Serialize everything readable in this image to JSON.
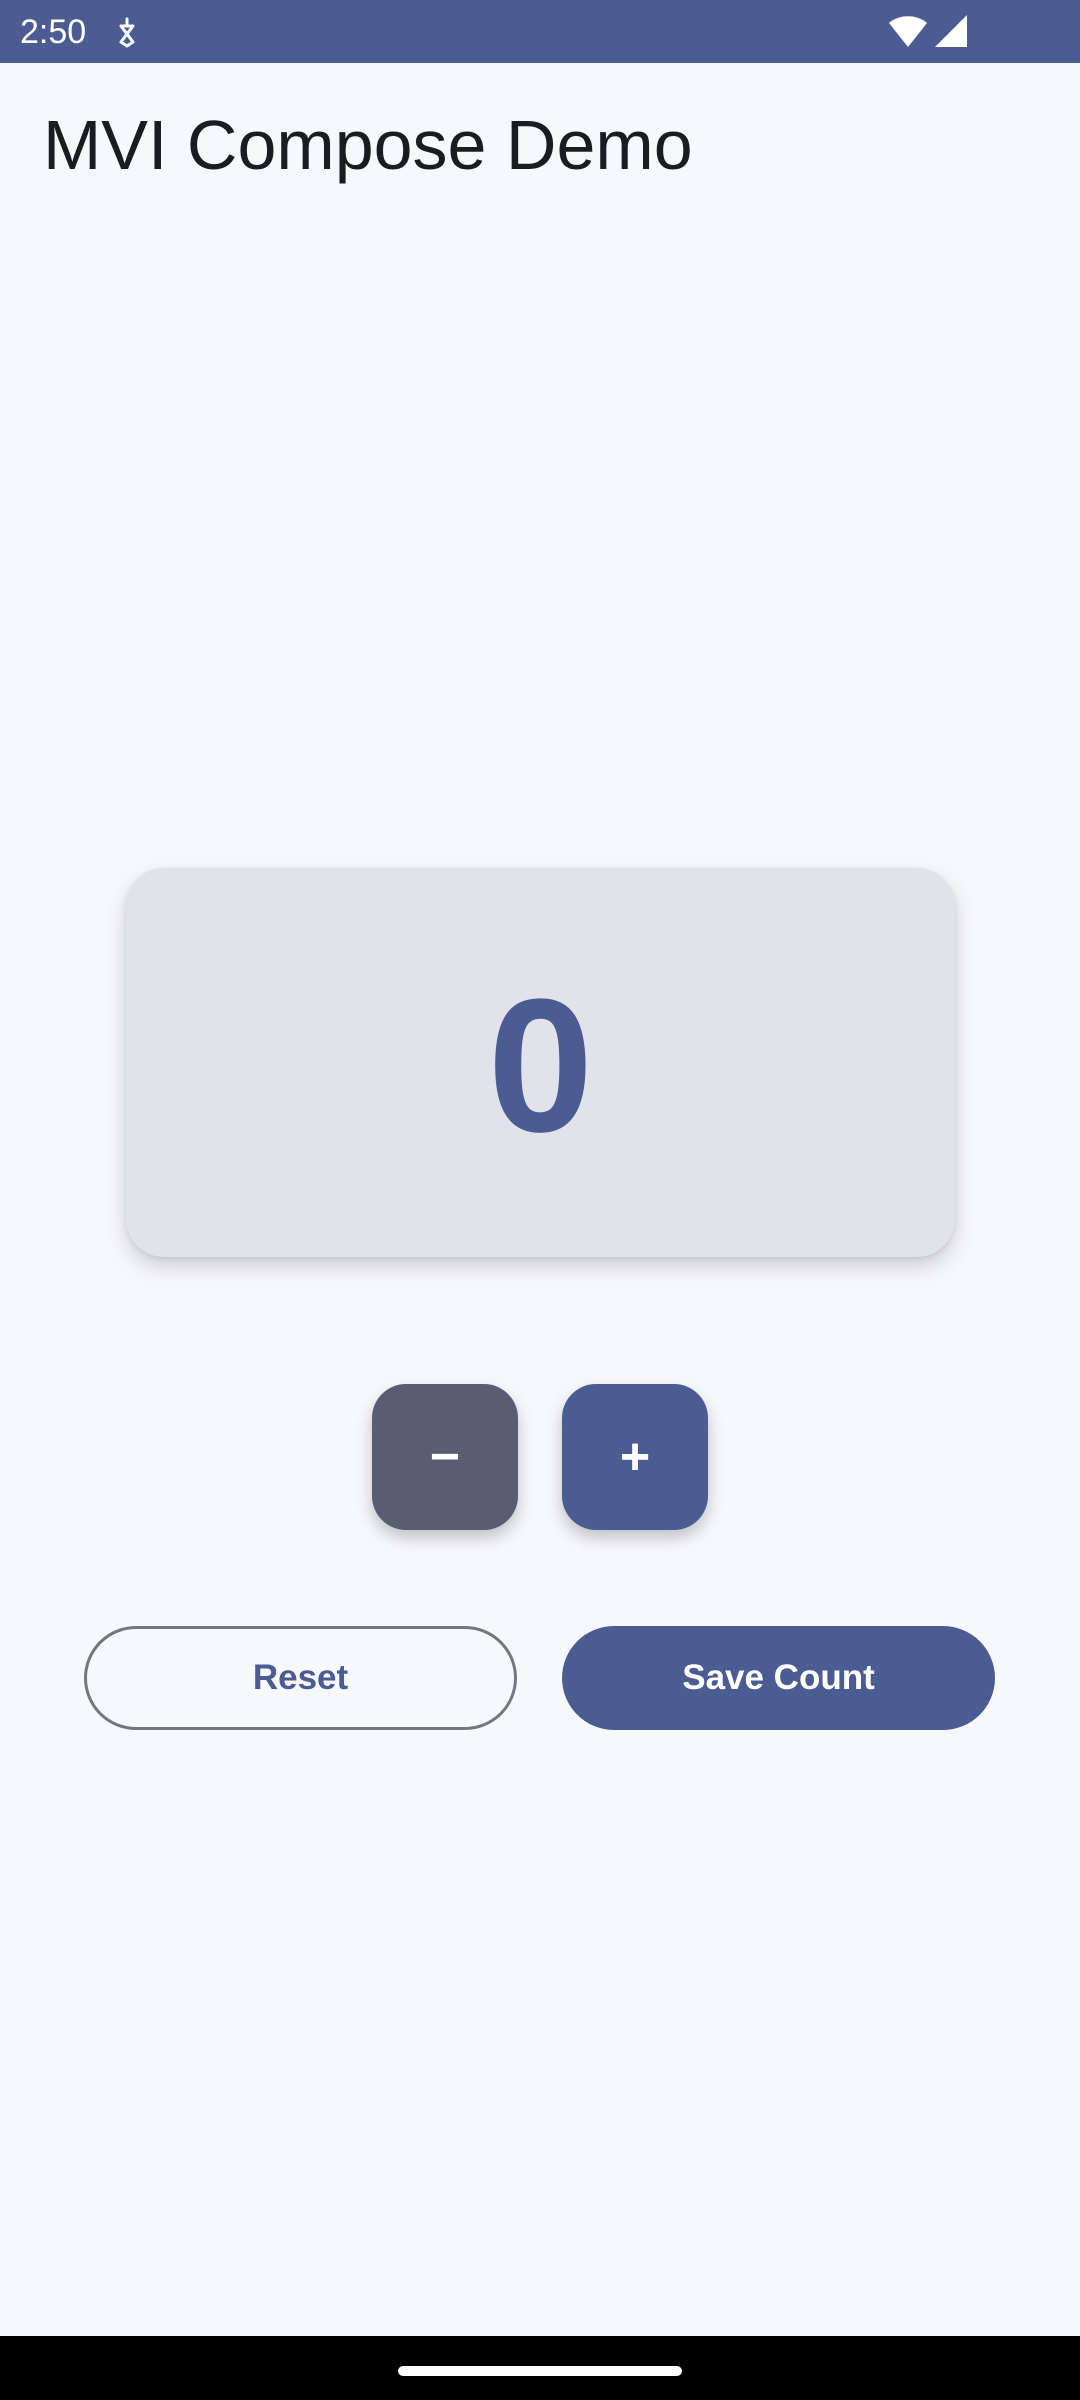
{
  "status_bar": {
    "time": "2:50",
    "background": "#4A5C92",
    "icons": [
      "notification-icon",
      "wifi-icon",
      "cell-signal-icon"
    ]
  },
  "app": {
    "title": "MVI Compose Demo"
  },
  "counter": {
    "value": "0"
  },
  "stepper": {
    "decrement_label": "−",
    "increment_label": "+"
  },
  "actions": {
    "reset_label": "Reset",
    "save_label": "Save Count"
  },
  "colors": {
    "primary": "#4A5C92",
    "secondary": "#595D72",
    "surface": "#F7F8FC",
    "card": "#E2E2EB",
    "outline": "#757780"
  }
}
